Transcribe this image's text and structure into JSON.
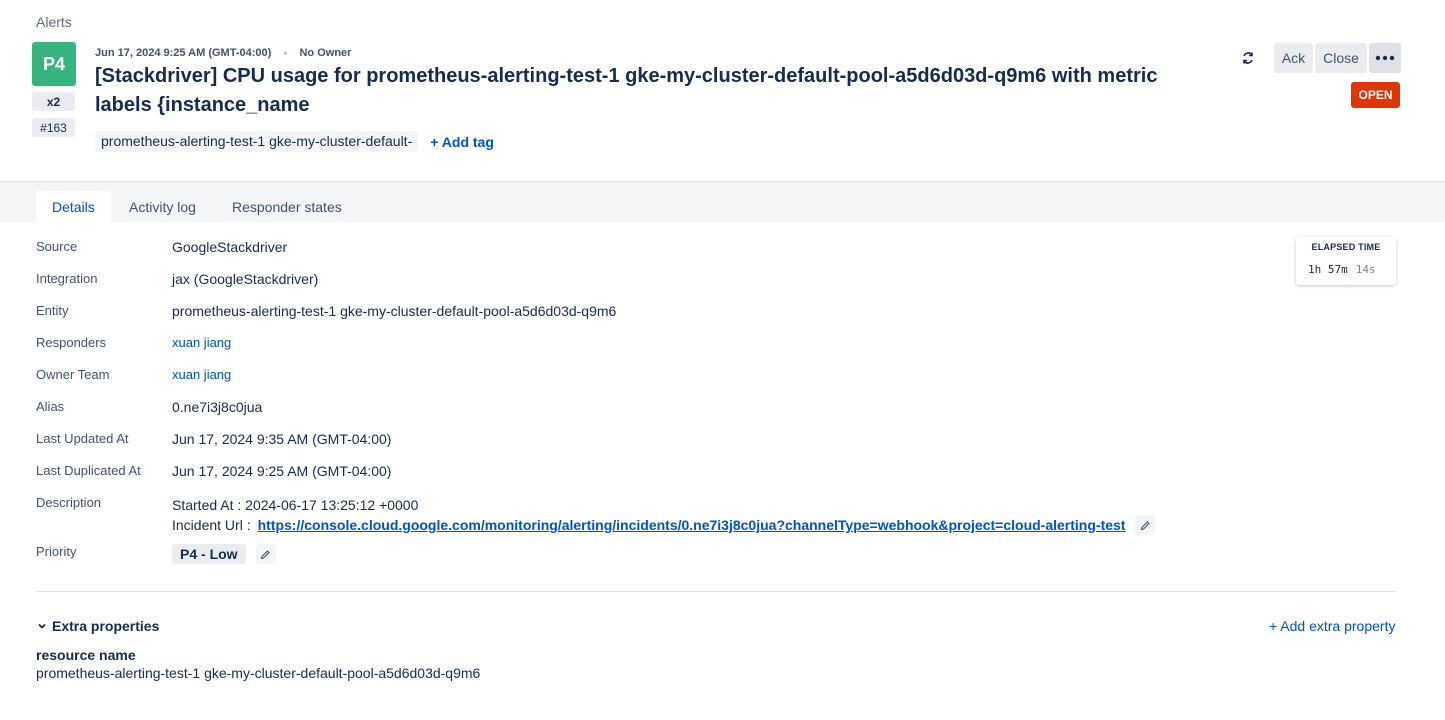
{
  "breadcrumb": "Alerts",
  "alert": {
    "priority": "P4",
    "count": "x2",
    "tiny_id": "#163",
    "created": "Jun 17, 2024 9:25 AM (GMT-04:00)",
    "owner": "No Owner",
    "title": "[Stackdriver] CPU usage for prometheus-alerting-test-1 gke-my-cluster-default-pool-a5d6d03d-q9m6 with metric labels {instance_name",
    "tag": "prometheus-alerting-test-1 gke-my-cluster-default-",
    "add_tag": "+ Add tag",
    "status": "OPEN",
    "priority_color": "#36b37e",
    "status_color": "#de350b"
  },
  "actions": {
    "refresh_icon": "refresh-icon",
    "ack": "Ack",
    "close": "Close",
    "more_icon": "more-icon"
  },
  "tabs": [
    {
      "label": "Details",
      "active": true
    },
    {
      "label": "Activity log",
      "active": false
    },
    {
      "label": "Responder states",
      "active": false
    }
  ],
  "details": {
    "source": {
      "label": "Source",
      "value": "GoogleStackdriver"
    },
    "integration": {
      "label": "Integration",
      "value": "jax (GoogleStackdriver)"
    },
    "entity": {
      "label": "Entity",
      "value": "prometheus-alerting-test-1 gke-my-cluster-default-pool-a5d6d03d-q9m6"
    },
    "responders": {
      "label": "Responders",
      "value": "xuan jiang"
    },
    "owner_team": {
      "label": "Owner Team",
      "value": "xuan jiang"
    },
    "alias": {
      "label": "Alias",
      "value": "0.ne7i3j8c0jua"
    },
    "last_updated": {
      "label": "Last Updated At",
      "value": "Jun 17, 2024 9:35 AM (GMT-04:00)"
    },
    "last_duplicated": {
      "label": "Last Duplicated At",
      "value": "Jun 17, 2024 9:25 AM (GMT-04:00)"
    },
    "description": {
      "label": "Description",
      "line1": "Started At : 2024-06-17 13:25:12 +0000",
      "url_prefix": "Incident Url :",
      "url": "https://console.cloud.google.com/monitoring/alerting/incidents/0.ne7i3j8c0jua?channelType=webhook&project=cloud-alerting-test"
    },
    "priority": {
      "label": "Priority",
      "value": "P4 - Low"
    }
  },
  "elapsed": {
    "title": "ELAPSED TIME",
    "value": "1h 57m",
    "seconds": "14s"
  },
  "extra": {
    "title": "Extra properties",
    "add": "+ Add extra property",
    "props": [
      {
        "name": "resource name",
        "value": "prometheus-alerting-test-1 gke-my-cluster-default-pool-a5d6d03d-q9m6"
      }
    ]
  }
}
